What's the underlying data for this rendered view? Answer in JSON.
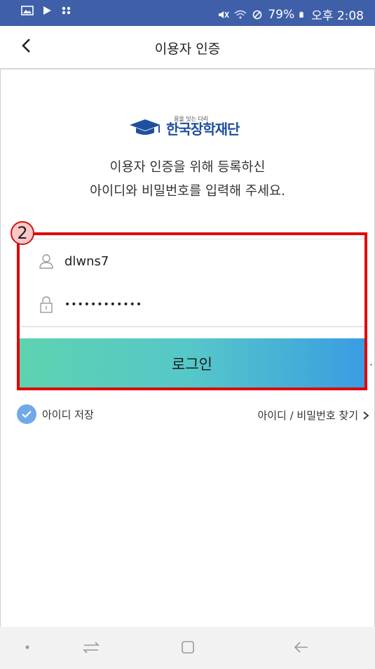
{
  "status_bar": {
    "battery_text": "79%",
    "time": "오후 2:08"
  },
  "header": {
    "title": "이용자 인증"
  },
  "logo": {
    "text": "한국장학재단",
    "small_text": "꿈을 잇는 다리"
  },
  "description": {
    "line1": "이용자 인증을 위해 등록하신",
    "line2": "아이디와 비밀번호를 입력해 주세요."
  },
  "annotation": {
    "step_number": "2",
    "color": "#e10000"
  },
  "form": {
    "id_value": "dlwns7",
    "password_value": "wqqqqqqqqqqq",
    "login_label": "로그인"
  },
  "options": {
    "save_id_label": "아이디 저장",
    "find_label": "아이디 / 비밀번호 찾기"
  },
  "colors": {
    "status_bar": "#3f5fa8",
    "button_gradient_start": "#5dd3b0",
    "button_gradient_end": "#3a9de2",
    "brand": "#1f4f9e"
  },
  "icons": {
    "back": "chevron-left-icon",
    "user": "user-icon",
    "lock": "lock-icon",
    "check": "check-icon",
    "nav_recent": "recent-apps-icon",
    "nav_home": "home-icon",
    "nav_back": "back-arrow-icon"
  }
}
